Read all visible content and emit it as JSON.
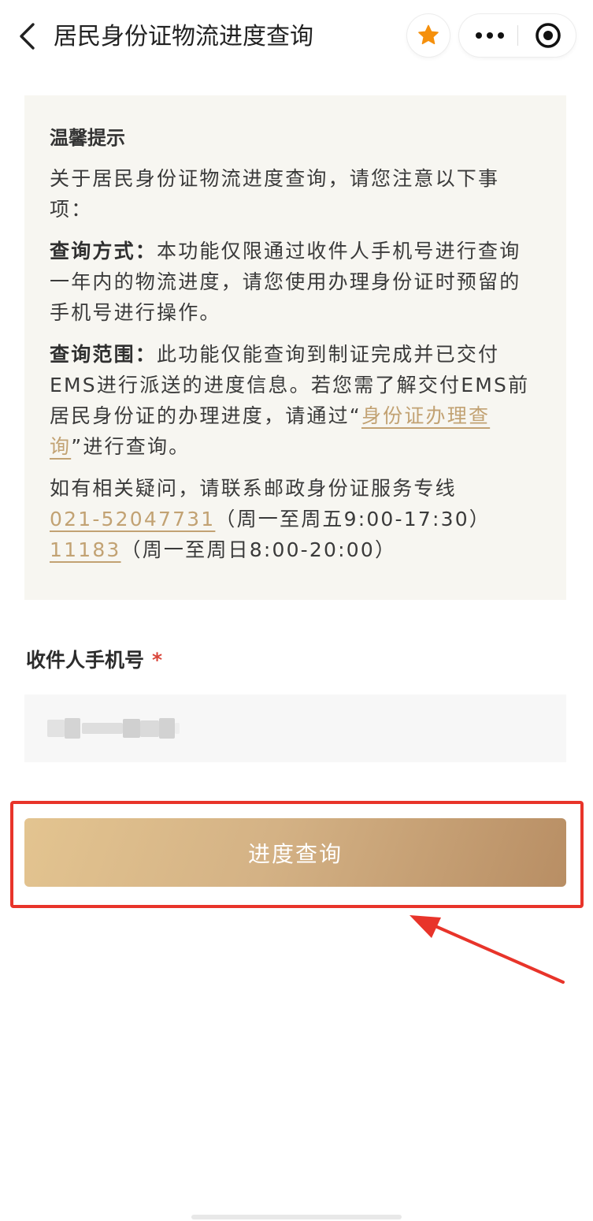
{
  "nav": {
    "title": "居民身份证物流进度查询",
    "back_icon": "chevron-left-icon",
    "favorite_icon": "star-icon",
    "more_icon": "more-dots-icon",
    "close_icon": "target-circle-icon"
  },
  "notice": {
    "title": "温馨提示",
    "intro": "关于居民身份证物流进度查询，请您注意以下事项：",
    "method_label": "查询方式：",
    "method_text": "本功能仅限通过收件人手机号进行查询一年内的物流进度，请您使用办理身份证时预留的手机号进行操作。",
    "scope_label": "查询范围：",
    "scope_text_before": "此功能仅能查询到制证完成并已交付EMS进行派送的进度信息。若您需了解交付EMS前居民身份证的办理进度，请通过“",
    "scope_link": "身份证办理查询",
    "scope_text_after": "”进行查询。",
    "contact_intro": "如有相关疑问，请联系邮政身份证服务专线",
    "phone1": "021-52047731",
    "phone1_hours": "（周一至周五9:00-17:30）",
    "phone2": "11183",
    "phone2_hours": "（周一至周日8:00-20:00）"
  },
  "form": {
    "phone_label": "收件人手机号",
    "required_mark": "*",
    "phone_value": ""
  },
  "submit": {
    "label": "进度查询"
  },
  "colors": {
    "accent": "#c2a273",
    "notice_bg": "#f7f6f1",
    "button_gradient_start": "#e3c490",
    "button_gradient_end": "#b88e64",
    "annotation_red": "#e8342a",
    "required_red": "#d9453a"
  }
}
